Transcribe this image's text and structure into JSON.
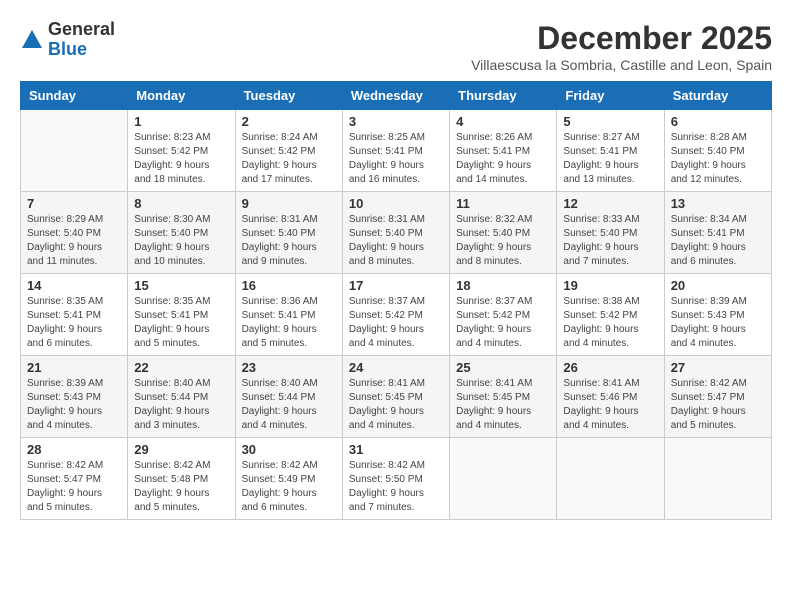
{
  "logo": {
    "general": "General",
    "blue": "Blue"
  },
  "title": "December 2025",
  "subtitle": "Villaescusa la Sombria, Castille and Leon, Spain",
  "days_of_week": [
    "Sunday",
    "Monday",
    "Tuesday",
    "Wednesday",
    "Thursday",
    "Friday",
    "Saturday"
  ],
  "weeks": [
    [
      {
        "day": "",
        "info": ""
      },
      {
        "day": "1",
        "info": "Sunrise: 8:23 AM\nSunset: 5:42 PM\nDaylight: 9 hours\nand 18 minutes."
      },
      {
        "day": "2",
        "info": "Sunrise: 8:24 AM\nSunset: 5:42 PM\nDaylight: 9 hours\nand 17 minutes."
      },
      {
        "day": "3",
        "info": "Sunrise: 8:25 AM\nSunset: 5:41 PM\nDaylight: 9 hours\nand 16 minutes."
      },
      {
        "day": "4",
        "info": "Sunrise: 8:26 AM\nSunset: 5:41 PM\nDaylight: 9 hours\nand 14 minutes."
      },
      {
        "day": "5",
        "info": "Sunrise: 8:27 AM\nSunset: 5:41 PM\nDaylight: 9 hours\nand 13 minutes."
      },
      {
        "day": "6",
        "info": "Sunrise: 8:28 AM\nSunset: 5:40 PM\nDaylight: 9 hours\nand 12 minutes."
      }
    ],
    [
      {
        "day": "7",
        "info": "Sunrise: 8:29 AM\nSunset: 5:40 PM\nDaylight: 9 hours\nand 11 minutes."
      },
      {
        "day": "8",
        "info": "Sunrise: 8:30 AM\nSunset: 5:40 PM\nDaylight: 9 hours\nand 10 minutes."
      },
      {
        "day": "9",
        "info": "Sunrise: 8:31 AM\nSunset: 5:40 PM\nDaylight: 9 hours\nand 9 minutes."
      },
      {
        "day": "10",
        "info": "Sunrise: 8:31 AM\nSunset: 5:40 PM\nDaylight: 9 hours\nand 8 minutes."
      },
      {
        "day": "11",
        "info": "Sunrise: 8:32 AM\nSunset: 5:40 PM\nDaylight: 9 hours\nand 8 minutes."
      },
      {
        "day": "12",
        "info": "Sunrise: 8:33 AM\nSunset: 5:40 PM\nDaylight: 9 hours\nand 7 minutes."
      },
      {
        "day": "13",
        "info": "Sunrise: 8:34 AM\nSunset: 5:41 PM\nDaylight: 9 hours\nand 6 minutes."
      }
    ],
    [
      {
        "day": "14",
        "info": "Sunrise: 8:35 AM\nSunset: 5:41 PM\nDaylight: 9 hours\nand 6 minutes."
      },
      {
        "day": "15",
        "info": "Sunrise: 8:35 AM\nSunset: 5:41 PM\nDaylight: 9 hours\nand 5 minutes."
      },
      {
        "day": "16",
        "info": "Sunrise: 8:36 AM\nSunset: 5:41 PM\nDaylight: 9 hours\nand 5 minutes."
      },
      {
        "day": "17",
        "info": "Sunrise: 8:37 AM\nSunset: 5:42 PM\nDaylight: 9 hours\nand 4 minutes."
      },
      {
        "day": "18",
        "info": "Sunrise: 8:37 AM\nSunset: 5:42 PM\nDaylight: 9 hours\nand 4 minutes."
      },
      {
        "day": "19",
        "info": "Sunrise: 8:38 AM\nSunset: 5:42 PM\nDaylight: 9 hours\nand 4 minutes."
      },
      {
        "day": "20",
        "info": "Sunrise: 8:39 AM\nSunset: 5:43 PM\nDaylight: 9 hours\nand 4 minutes."
      }
    ],
    [
      {
        "day": "21",
        "info": "Sunrise: 8:39 AM\nSunset: 5:43 PM\nDaylight: 9 hours\nand 4 minutes."
      },
      {
        "day": "22",
        "info": "Sunrise: 8:40 AM\nSunset: 5:44 PM\nDaylight: 9 hours\nand 3 minutes."
      },
      {
        "day": "23",
        "info": "Sunrise: 8:40 AM\nSunset: 5:44 PM\nDaylight: 9 hours\nand 4 minutes."
      },
      {
        "day": "24",
        "info": "Sunrise: 8:41 AM\nSunset: 5:45 PM\nDaylight: 9 hours\nand 4 minutes."
      },
      {
        "day": "25",
        "info": "Sunrise: 8:41 AM\nSunset: 5:45 PM\nDaylight: 9 hours\nand 4 minutes."
      },
      {
        "day": "26",
        "info": "Sunrise: 8:41 AM\nSunset: 5:46 PM\nDaylight: 9 hours\nand 4 minutes."
      },
      {
        "day": "27",
        "info": "Sunrise: 8:42 AM\nSunset: 5:47 PM\nDaylight: 9 hours\nand 5 minutes."
      }
    ],
    [
      {
        "day": "28",
        "info": "Sunrise: 8:42 AM\nSunset: 5:47 PM\nDaylight: 9 hours\nand 5 minutes."
      },
      {
        "day": "29",
        "info": "Sunrise: 8:42 AM\nSunset: 5:48 PM\nDaylight: 9 hours\nand 5 minutes."
      },
      {
        "day": "30",
        "info": "Sunrise: 8:42 AM\nSunset: 5:49 PM\nDaylight: 9 hours\nand 6 minutes."
      },
      {
        "day": "31",
        "info": "Sunrise: 8:42 AM\nSunset: 5:50 PM\nDaylight: 9 hours\nand 7 minutes."
      },
      {
        "day": "",
        "info": ""
      },
      {
        "day": "",
        "info": ""
      },
      {
        "day": "",
        "info": ""
      }
    ]
  ]
}
